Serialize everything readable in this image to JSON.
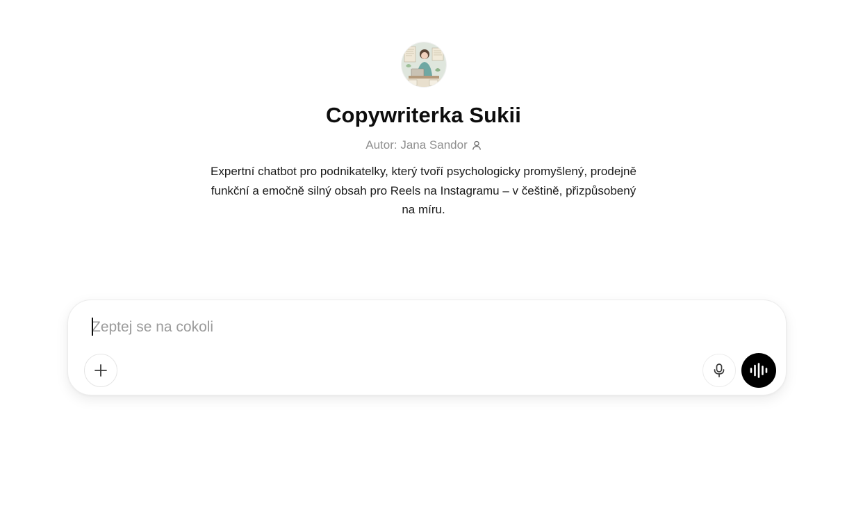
{
  "gpt": {
    "name": "Copywriterka Sukii",
    "author": "Autor: Jana Sandor",
    "description": "Expertní chatbot pro podnikatelky, který tvoří psychologicky promyšlený, prodejně funkční a emočně silný obsah pro Reels na Instagramu – v češtině, přizpůsobený na míru.",
    "avatar_icon": "illustration-woman-writing-avatar"
  },
  "composer": {
    "placeholder": "Zeptej se na cokoli",
    "value": "",
    "add_icon": "plus-icon",
    "mic_icon": "microphone-icon",
    "voice_icon": "voice-waveform-icon"
  },
  "colors": {
    "primary_text": "#0d0d0d",
    "muted_text": "#8f8f8f",
    "placeholder": "#9b9b9b",
    "voice_button_bg": "#000000"
  }
}
